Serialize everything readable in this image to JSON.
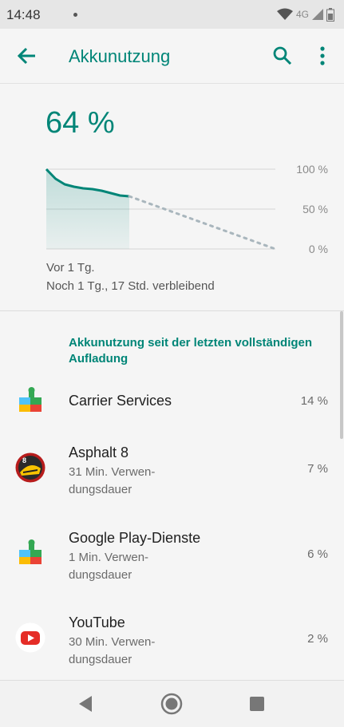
{
  "status_bar": {
    "time": "14:48",
    "network": "4G"
  },
  "app_bar": {
    "title": "Akkunutzung"
  },
  "battery": {
    "percent": "64 %",
    "since": "Vor 1 Tg.",
    "remaining": "Noch 1 Tg., 17 Std. verbleibend"
  },
  "chart_data": {
    "type": "line",
    "y_tick_labels": [
      "100 %",
      "50 %",
      "0 %"
    ],
    "ylim": [
      0,
      100
    ],
    "series": [
      {
        "values": [
          100,
          88,
          81,
          78,
          76,
          75,
          73,
          70,
          67,
          66
        ],
        "style": "solid"
      },
      {
        "values": [
          66,
          0
        ],
        "style": "dotted"
      }
    ]
  },
  "section": {
    "title": "Akkunutzung seit der letzten vollständigen Aufladung"
  },
  "apps": [
    {
      "name": "Carrier Services",
      "sub": "",
      "percent": "14 %",
      "icon": "puzzle-icon"
    },
    {
      "name": "Asphalt 8",
      "sub": "31 Min. Verwen-\ndungsdauer",
      "percent": "7 %",
      "icon": "asphalt-icon"
    },
    {
      "name": "Google Play-Dienste",
      "sub": "1 Min. Verwen-\ndungsdauer",
      "percent": "6 %",
      "icon": "puzzle-icon"
    },
    {
      "name": "YouTube",
      "sub": "30 Min. Verwen-\ndungsdauer",
      "percent": "2 %",
      "icon": "youtube-icon"
    }
  ],
  "colors": {
    "accent": "#008577",
    "background": "#f5f5f5",
    "dotted_line": "#a9b6bd"
  }
}
